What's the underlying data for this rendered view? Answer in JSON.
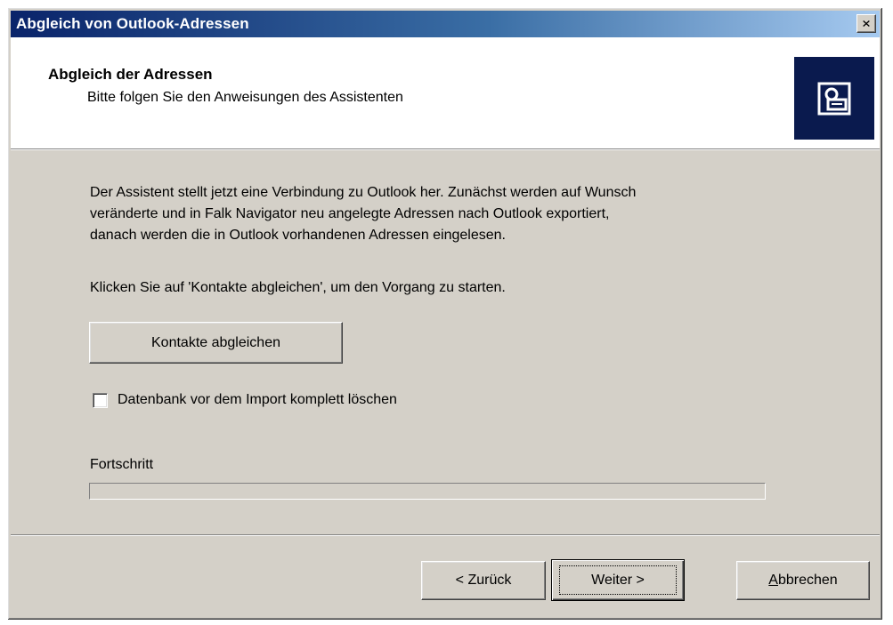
{
  "window": {
    "title": "Abgleich von Outlook-Adressen",
    "close_label": "×"
  },
  "header": {
    "title": "Abgleich der Adressen",
    "subtitle": "Bitte folgen Sie den Anweisungen des Assistenten",
    "icon": "address-sync-icon"
  },
  "body": {
    "description_lines": [
      "Der Assistent stellt jetzt eine Verbindung zu Outlook her. Zunächst werden auf Wunsch",
      "veränderte und in Falk Navigator  neu angelegte Adressen nach Outlook exportiert,",
      "danach werden die in Outlook vorhandenen Adressen eingelesen."
    ],
    "instruction": "Klicken Sie auf 'Kontakte abgleichen', um den Vorgang zu starten.",
    "sync_button_label": "Kontakte abgleichen",
    "delete_db_checkbox": {
      "label": "Datenbank vor dem Import komplett löschen",
      "checked": false
    },
    "progress": {
      "label": "Fortschritt",
      "value": 0
    }
  },
  "footer": {
    "back_label": "< Zurück",
    "next_label": "Weiter >",
    "cancel_label": "Abbrechen"
  },
  "colors": {
    "titlebar_start": "#0a246a",
    "titlebar_end": "#a6caf0",
    "dialog_bg": "#d4d0c8",
    "icon_box_bg": "#0a1a4e"
  }
}
